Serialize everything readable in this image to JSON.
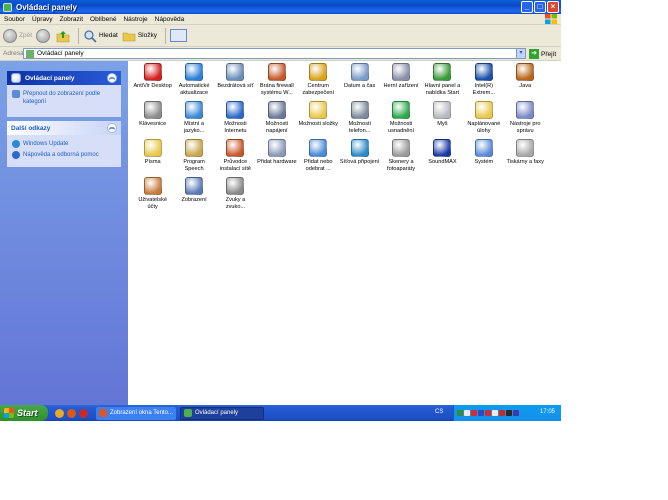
{
  "window": {
    "title": "Ovládací panely"
  },
  "menu": [
    "Soubor",
    "Úpravy",
    "Zobrazit",
    "Oblíbené",
    "Nástroje",
    "Nápověda"
  ],
  "toolbar": {
    "back": "Zpět",
    "forward": "",
    "search": "Hledat",
    "folders": "Složky"
  },
  "address": {
    "label": "Adresa",
    "value": "Ovládací panely",
    "go": "Přejít"
  },
  "sidebar": {
    "panel1": {
      "title": "Ovládací panely",
      "links": [
        "Přepnout do zobrazení podle kategorií"
      ]
    },
    "panel2": {
      "title": "Další odkazy",
      "links": [
        "Windows Update",
        "Nápověda a odborná pomoc"
      ]
    }
  },
  "items": [
    {
      "label": "AntiVir Desktop",
      "icon": "antivir-icon",
      "color": "#d32020"
    },
    {
      "label": "Automatické aktualizace",
      "icon": "globe-update-icon",
      "color": "#2a7fd6"
    },
    {
      "label": "Bezdrátová síť",
      "icon": "wireless-icon",
      "color": "#6a8fb8"
    },
    {
      "label": "Brána firewall systému W...",
      "icon": "firewall-icon",
      "color": "#c4582a"
    },
    {
      "label": "Centrum zabezpečení",
      "icon": "shield-icon",
      "color": "#d9a21a"
    },
    {
      "label": "Datum a čas",
      "icon": "clock-icon",
      "color": "#7a9ac8"
    },
    {
      "label": "Herní zařízení",
      "icon": "gamepad-icon",
      "color": "#8a8fa8"
    },
    {
      "label": "Hlavní panel a nabídka Start",
      "icon": "taskbar-icon",
      "color": "#3a9a3a"
    },
    {
      "label": "Intel(R) Extrem...",
      "icon": "intel-icon",
      "color": "#1a4fa8"
    },
    {
      "label": "Java",
      "icon": "java-icon",
      "color": "#b8651a"
    },
    {
      "label": "Klávesnice",
      "icon": "keyboard-icon",
      "color": "#8c8c8c"
    },
    {
      "label": "Místní a jazyko...",
      "icon": "globe-icon",
      "color": "#3a8ad8"
    },
    {
      "label": "Možnosti Internetu",
      "icon": "internet-icon",
      "color": "#2a6ac8"
    },
    {
      "label": "Možnosti napájení",
      "icon": "power-icon",
      "color": "#6a7a9a"
    },
    {
      "label": "Možnosti složky",
      "icon": "folder-options-icon",
      "color": "#e8c84a"
    },
    {
      "label": "Možnosti telefon...",
      "icon": "phone-icon",
      "color": "#7a8a9a"
    },
    {
      "label": "Možnosti usnadnění",
      "icon": "accessibility-icon",
      "color": "#2aa84a"
    },
    {
      "label": "Myš",
      "icon": "mouse-icon",
      "color": "#b8b8c0"
    },
    {
      "label": "Naplánované úlohy",
      "icon": "scheduled-tasks-icon",
      "color": "#e8c84a"
    },
    {
      "label": "Nástroje pro správu",
      "icon": "admin-tools-icon",
      "color": "#7a8ac8"
    },
    {
      "label": "Písma",
      "icon": "fonts-icon",
      "color": "#e8c84a"
    },
    {
      "label": "Program Speech",
      "icon": "speech-icon",
      "color": "#c8a84a"
    },
    {
      "label": "Průvodce instalací sítě",
      "icon": "network-wizard-icon",
      "color": "#c8582a"
    },
    {
      "label": "Přidat hardware",
      "icon": "add-hardware-icon",
      "color": "#8a9ab8"
    },
    {
      "label": "Přidat nebo odebrat ...",
      "icon": "add-remove-icon",
      "color": "#4a8ad8"
    },
    {
      "label": "Síťová připojení",
      "icon": "network-icon",
      "color": "#2a8ac8"
    },
    {
      "label": "Skenery a fotoaparáty",
      "icon": "scanner-icon",
      "color": "#9a9a9a"
    },
    {
      "label": "SoundMAX",
      "icon": "soundmax-icon",
      "color": "#1a3aa8"
    },
    {
      "label": "Systém",
      "icon": "system-icon",
      "color": "#5a8ad8"
    },
    {
      "label": "Tiskárny a faxy",
      "icon": "printer-icon",
      "color": "#a8a8a8"
    },
    {
      "label": "Uživatelské účty",
      "icon": "users-icon",
      "color": "#c87a3a"
    },
    {
      "label": "Zobrazení",
      "icon": "display-icon",
      "color": "#5a7ab8"
    },
    {
      "label": "Zvuky a zvuko...",
      "icon": "speaker-icon",
      "color": "#8a8a8a"
    }
  ],
  "taskbar": {
    "start": "Start",
    "tasks": [
      "Zobrazení okna Tento...",
      "Ovládací panely"
    ],
    "lang": "CS",
    "clock": "17:05"
  }
}
